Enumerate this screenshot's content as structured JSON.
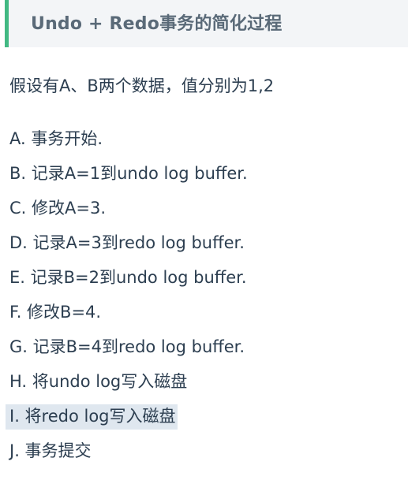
{
  "heading": {
    "title": "Undo + Redo事务的简化过程"
  },
  "intro": {
    "text": "假设有A、B两个数据，值分别为1,2"
  },
  "steps": [
    {
      "text": "A. 事务开始."
    },
    {
      "text": "B. 记录A=1到undo log buffer."
    },
    {
      "text": "C. 修改A=3."
    },
    {
      "text": "D. 记录A=3到redo log buffer."
    },
    {
      "text": "E. 记录B=2到undo log buffer."
    },
    {
      "text": "F. 修改B=4."
    },
    {
      "text": "G. 记录B=4到redo log buffer."
    },
    {
      "text": "H. 将undo log写入磁盘"
    },
    {
      "text": "I. 将redo log写入磁盘",
      "highlighted": true
    },
    {
      "text": "J. 事务提交"
    }
  ],
  "colors": {
    "accent_border": "#42b983",
    "heading_background": "#f3f5f7",
    "selection_highlight": "#dfe7ef"
  }
}
